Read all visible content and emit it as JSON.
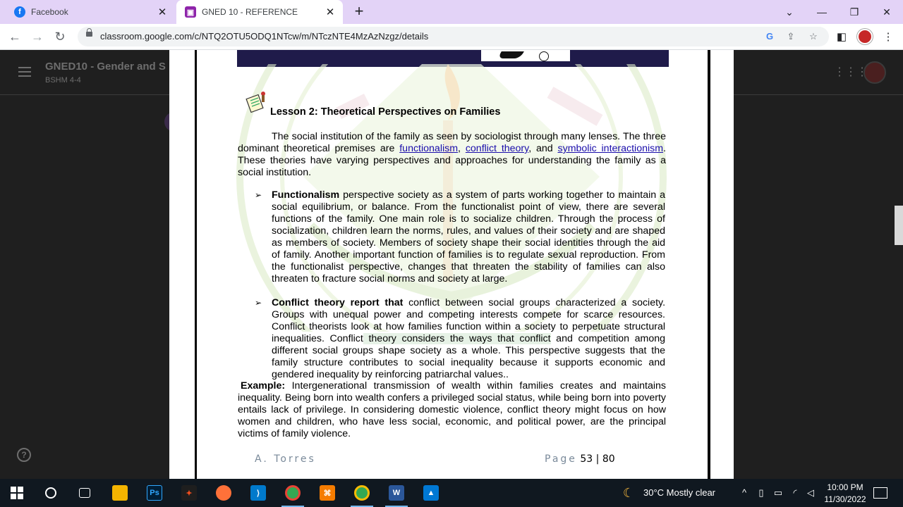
{
  "browser": {
    "tabs": [
      {
        "title": "Facebook",
        "active": false
      },
      {
        "title": "GNED 10 - REFERENCE",
        "active": true
      }
    ],
    "new_tab": "+",
    "url": "classroom.google.com/c/NTQ2OTU5ODQ1NTcw/m/NTczNTE4MzAzNzgz/details"
  },
  "classroom": {
    "course_title": "GNED10 - Gender and S",
    "section": "BSHM 4-4",
    "help": "?"
  },
  "document": {
    "lesson_title": "Lesson 2: Theoretical Perspectives on Families",
    "intro": {
      "text1": "The social institution of the family as seen by sociologist through many lenses. The three dominant theoretical premises are ",
      "link1": "functionalism",
      "sep1": ", ",
      "link2": "conflict theory",
      "sep2": ", and ",
      "link3": "symbolic interactionism",
      "text2": ". These theories have varying perspectives and approaches for understanding the family as a social institution."
    },
    "bullet1": {
      "bold": "Functionalism",
      "text": " perspective society as a system of parts working together to maintain a social equilibrium, or balance. From the functionalist point of view, there are several functions of the family. One main role is to socialize children. Through the process of socialization, children learn the norms, rules, and values of their society and are shaped as members of society. Members of society shape their social identities through the aid of family. Another important function of families is to regulate sexual reproduction. From the functionalist perspective, changes that threaten the stability of families can also threaten to fracture social norms and society at large."
    },
    "bullet2": {
      "bold": "Conflict theory report that",
      "text1": " conflict between social groups characterized a society. Groups with unequal power and competing interests compete for scarce resources. Conflict theorists look at how families function within a society to perpetuate structural inequalities. Conflict",
      "highlight": " theory considers the ways that conflict",
      "text2": " and competition among different social groups shape society as a whole. This perspective suggests that the family structure contributes to social inequality because it supports economic and gendered inequality by reinforcing patriarchal values.."
    },
    "example": {
      "bold": "Example:",
      "text": " Intergenerational transmission of wealth within families creates and maintains inequality. Being born into wealth confers a privileged social status, while being born into poverty entails lack of privilege. In considering domestic violence, conflict theory might focus on how women and children, who have less social, economic, and political power, are the principal victims of family violence."
    },
    "footer": {
      "author": "A. Torres",
      "page_label": "Page",
      "page_num": "53",
      "page_sep": "|",
      "page_total": "80"
    }
  },
  "taskbar": {
    "weather": "30°C  Mostly clear",
    "time": "10:00 PM",
    "date": "11/30/2022"
  }
}
